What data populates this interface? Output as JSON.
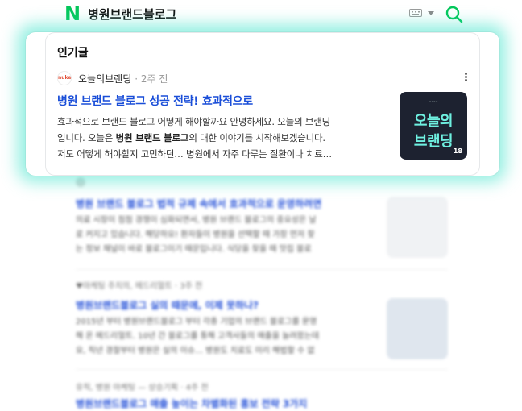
{
  "header": {
    "logo_letter": "N",
    "search_query": "병원브랜드블로그",
    "icons": [
      "keyboard-icon",
      "chevron-down-icon",
      "search-icon"
    ],
    "brand_color": "#03c75a"
  },
  "popular": {
    "section_title": "인기글",
    "author_avatar_text": "nuke",
    "author": "오늘의브랜딩",
    "time": "· 2주 전",
    "title": "병원 브랜드 블로그 성공 전략! 효과적으로",
    "excerpt_line1": "효과적으로 브랜드 블로그 어떻게 해야할까요 안녕하세요. 오늘의 브랜딩",
    "excerpt_line2_pre": "입니다. 오늘은 ",
    "excerpt_line2_bold": "병원 브랜드 블로그",
    "excerpt_line2_post": "의 대한 이야기를 시작해보겠습니다.",
    "excerpt_line3": "저도 어떻게 해야할지 고민하던… 병원에서 자주 다루는 질환이나 치료…",
    "thumb_line1": "오늘의",
    "thumb_line2": "브랜딩",
    "thumb_badge": "18",
    "glow_color": "#39e2c9",
    "link_color": "#1a4ed8"
  },
  "list": [
    {
      "title": "병원 브랜드 블로그 법적 규제 속에서 효과적으로 운영하려면",
      "text1": "의료 시장이 점점 경쟁이 심화되면서, 병원 브랜드 블로그의 중요성은 날",
      "text2": "로 커지고 있습니다. 해당하요! 환자들이 병원을 선택할 때 가장 먼저 찾",
      "text3": "는 정보 채널이 바로 블로그이기 때문입니다. 식당을 찾을 때 맛집 블로"
    },
    {
      "author": "♥마케팅 주치의, 메드리얼트 · 3주 전",
      "title": "병원브랜드블로그 실의 때문에, 이제 못하나?",
      "text1": "2015년 부터 병원브랜드블로그 부터 각종 기업의 브랜드 블로그를 운영",
      "text2": "해 온 메드리얼트. 10년 간 블로그를 통해 고객사들의 매출을 늘려왔는데",
      "text3": "요, 직년 경찰부터 병원은 실의 이슈… 병원도 치료도 미리 해법할 수 없"
    },
    {
      "author": "유직, 병원 마케팅 — 상승기획 · 4주 전",
      "title": "병원브랜드블로그 매출 높이는 차별화된 홍보 전략 3가지"
    }
  ]
}
